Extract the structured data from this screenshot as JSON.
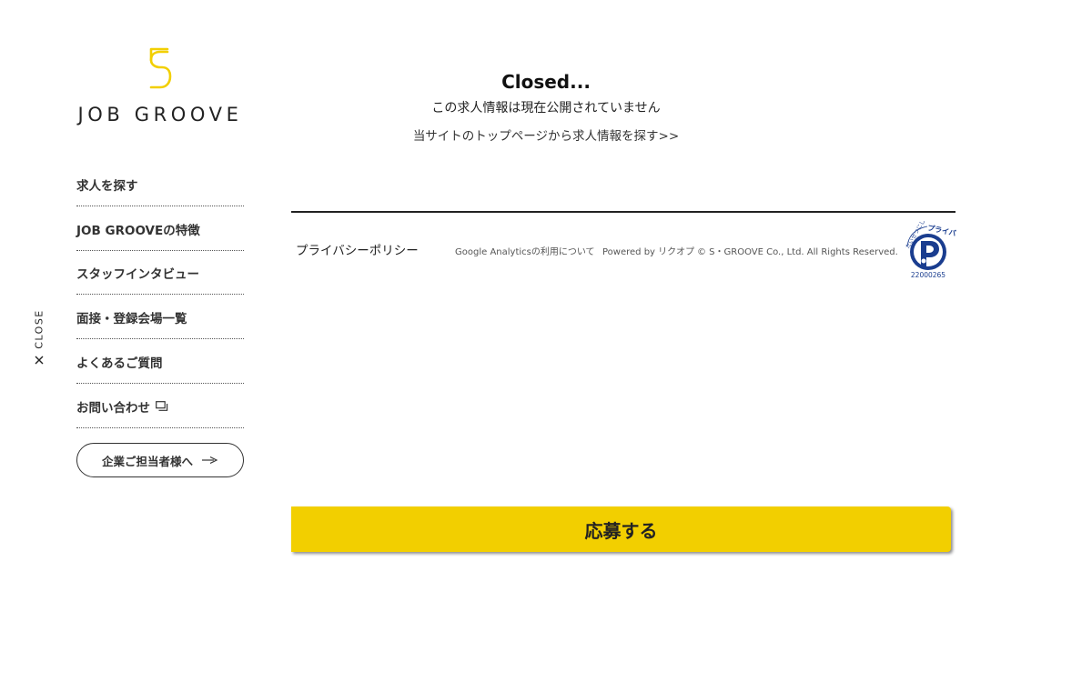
{
  "close_tab": {
    "label": "CLOSE"
  },
  "logo": {
    "text": "JOB GROOVE",
    "mark_color": "#f2cf00"
  },
  "nav": {
    "items": [
      {
        "label": "求人を探す"
      },
      {
        "label": "JOB GROOVEの特徴"
      },
      {
        "label": "スタッフインタビュー"
      },
      {
        "label": "面接・登録会場一覧"
      },
      {
        "label": "よくあるご質問"
      },
      {
        "label": "お問い合わせ",
        "icon": "external-window-icon"
      }
    ],
    "corporate_button": {
      "label": "企業ご担当者様へ",
      "icon": "arrow-right-icon"
    }
  },
  "main": {
    "title": "Closed...",
    "subtitle": "この求人情報は現在公開されていません",
    "top_link": "当サイトのトップページから求人情報を探す>>"
  },
  "footer": {
    "privacy": "プライバシーポリシー",
    "analytics": "Google Analyticsの利用について",
    "powered": "Powered by リクオプ",
    "copyright": "© S・GROOVE Co., Ltd. All Rights Reserved.",
    "pmark": {
      "caption": "たいせつにしますプライバシー",
      "number": "22000265",
      "color": "#1a3d8f"
    }
  },
  "apply": {
    "label": "応募する",
    "color": "#f2cf00"
  },
  "colors": {
    "accent": "#f2cf00",
    "text": "#222222",
    "background": "#ffffff"
  }
}
